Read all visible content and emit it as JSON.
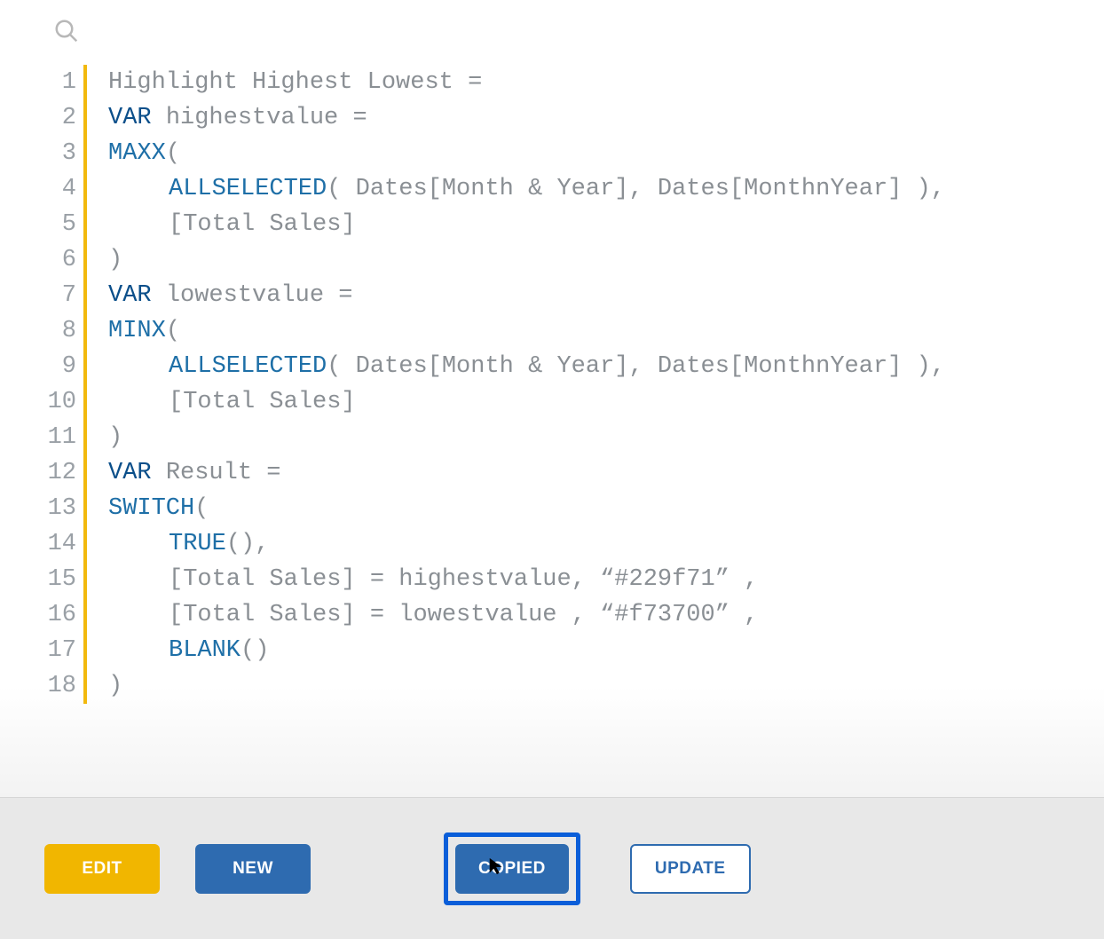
{
  "code": {
    "lines": [
      {
        "num": "1"
      },
      {
        "num": "2"
      },
      {
        "num": "3"
      },
      {
        "num": "4"
      },
      {
        "num": "5"
      },
      {
        "num": "6"
      },
      {
        "num": "7"
      },
      {
        "num": "8"
      },
      {
        "num": "9"
      },
      {
        "num": "10"
      },
      {
        "num": "11"
      },
      {
        "num": "12"
      },
      {
        "num": "13"
      },
      {
        "num": "14"
      },
      {
        "num": "15"
      },
      {
        "num": "16"
      },
      {
        "num": "17"
      },
      {
        "num": "18"
      }
    ],
    "tokens": {
      "measure_name": "Highlight Highest Lowest ",
      "eq": "=",
      "var": "VAR",
      "highestvalue": "highestvalue ",
      "lowestvalue": "lowestvalue ",
      "result": "Result ",
      "maxx": "MAXX",
      "minx": "MINX",
      "switch": "SWITCH",
      "true": "TRUE",
      "blank": "BLANK",
      "allselected": "ALLSELECTED",
      "open": "(",
      "close": ")",
      "comma": ",",
      "dates_monthyear": "Dates[Month & Year]",
      "dates_monthnyear": "Dates[MonthnYear]",
      "total_sales": "[Total Sales]",
      "eq2": " = ",
      "highestvalue_ref": "highestvalue",
      "lowestvalue_ref": "lowestvalue ",
      "color_high": "“#229f71” ",
      "color_low": "“#f73700” ",
      "sp": " "
    }
  },
  "buttons": {
    "edit": "EDIT",
    "new": "NEW",
    "copied": "COPIED",
    "update": "UPDATE"
  }
}
